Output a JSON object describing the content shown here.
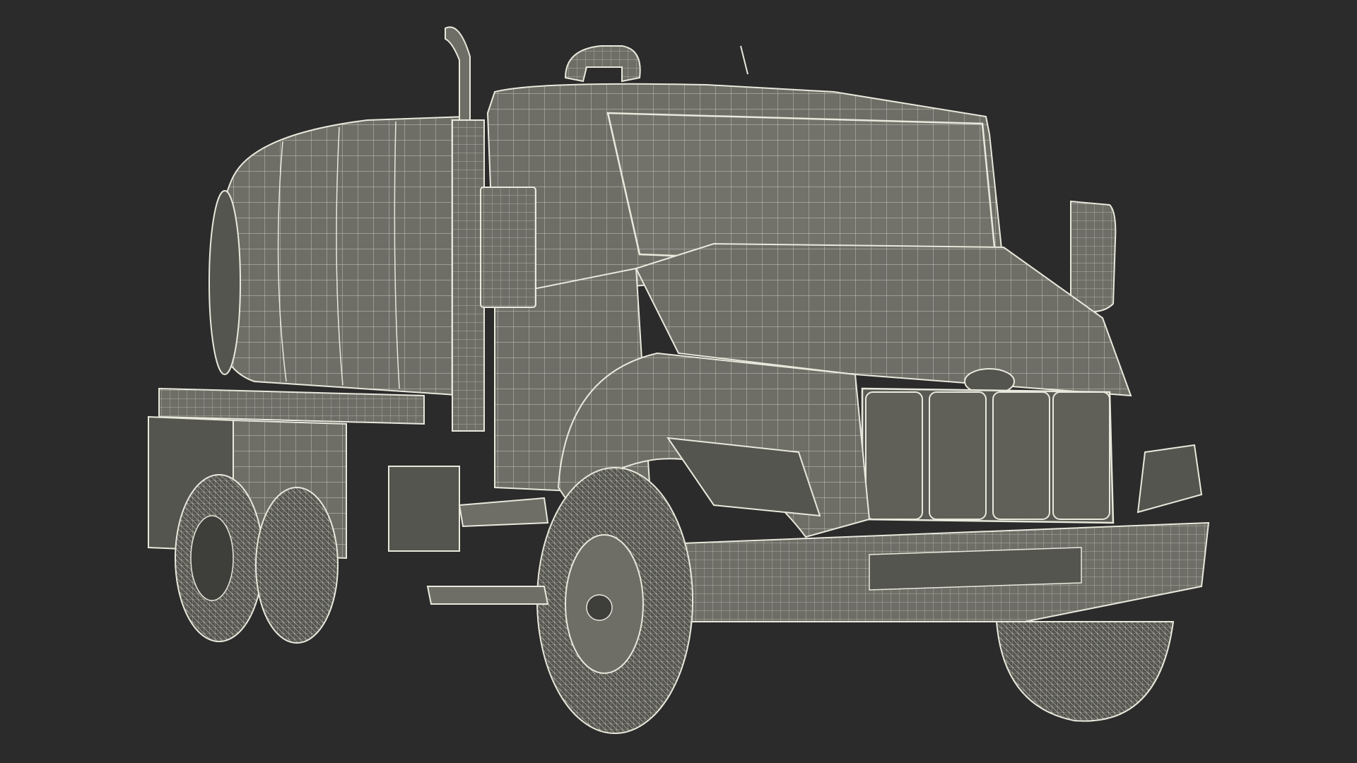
{
  "scene": {
    "subject": "wireframe-render-3d-model",
    "background_color": "#2b2b2b",
    "mesh_fill_color": "#6e6e67",
    "mesh_dark_fill_color": "#55554f",
    "wire_color": "#e8e8dc",
    "shadow_color": "#3e3e3a"
  }
}
